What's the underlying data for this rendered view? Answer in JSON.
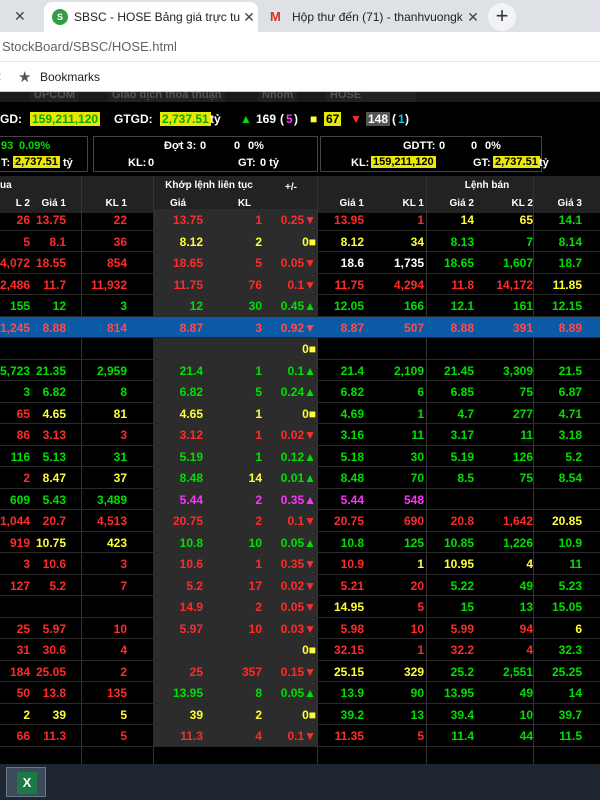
{
  "browser": {
    "tabs": [
      {
        "title": "SBSC - HOSE Bảng giá trực tuyến",
        "favicon": "S"
      },
      {
        "title": "Hộp thư đến (71) - thanhvuongk",
        "favicon": "M"
      }
    ],
    "close_glyph": "✕",
    "new_tab_glyph": "+",
    "url": "StockBoard/SBSC/HOSE.html",
    "bookmarks_label": "Bookmarks",
    "apps_glyph": ":"
  },
  "board": {
    "menu_tabs": [
      "UPCOM",
      "Giao dịch thỏa thuận",
      "Nhóm",
      "HOSE"
    ],
    "summary": {
      "gd_label": "GD:",
      "gd_value": "159,211,120",
      "gtgd_label": "GTGD:",
      "gtgd_value": "2,737.51",
      "gtgd_unit": "tỷ",
      "up_count": "169",
      "up_extra": "5",
      "ref_count": "67",
      "down_count": "148",
      "down_extra": "1"
    },
    "box1": {
      "line1_a": "93",
      "line1_b": "0.09%",
      "line2_a": "T:",
      "line2_b": "2,737.51",
      "line2_unit": "tỷ"
    },
    "box2": {
      "label": "Đợt 3:",
      "v1": "0",
      "v2": "0",
      "v3": "0%",
      "kl_label": "KL:",
      "kl": "0",
      "gt_label": "GT:",
      "gt": "0 tỷ"
    },
    "box3": {
      "label": "GDTT:",
      "v1": "0",
      "v2": "0",
      "v3": "0%",
      "kl_label": "KL:",
      "kl": "159,211,120",
      "gt_label": "GT:",
      "gt": "2,737.51",
      "gt_unit": "tỷ"
    },
    "header_groups": {
      "left": "ua",
      "match": "Khớp lệnh liên tục",
      "change": "+/-",
      "sell": "Lệnh bán"
    },
    "columns": [
      "L 2",
      "Giá 1",
      "KL 1",
      "Giá",
      "KL",
      "",
      "Giá 1",
      "KL 1",
      "Giá 2",
      "KL 2",
      "Giá 3"
    ],
    "rows": [
      {
        "c": [
          "26",
          "13.75",
          "22",
          "13.75",
          "1",
          "0.25▼",
          "13.95",
          "1",
          "14",
          "65",
          "14.1"
        ],
        "k": [
          "r",
          "r",
          "r",
          "r",
          "r",
          "r",
          "r",
          "r",
          "y",
          "y",
          "g"
        ]
      },
      {
        "c": [
          "5",
          "8.1",
          "36",
          "8.12",
          "2",
          "0■",
          "8.12",
          "34",
          "8.13",
          "7",
          "8.14"
        ],
        "k": [
          "r",
          "r",
          "r",
          "y",
          "y",
          "y",
          "y",
          "y",
          "g",
          "g",
          "g"
        ]
      },
      {
        "c": [
          "4,072",
          "18.55",
          "854",
          "18.65",
          "5",
          "0.05▼",
          "18.6",
          "1,735",
          "18.65",
          "1,607",
          "18.7"
        ],
        "k": [
          "r",
          "r",
          "r",
          "r",
          "r",
          "r",
          "w",
          "w",
          "g",
          "g",
          "g"
        ]
      },
      {
        "c": [
          "2,486",
          "11.7",
          "11,932",
          "11.75",
          "76",
          "0.1▼",
          "11.75",
          "4,294",
          "11.8",
          "14,172",
          "11.85"
        ],
        "k": [
          "r",
          "r",
          "r",
          "r",
          "r",
          "r",
          "r",
          "r",
          "r",
          "r",
          "y"
        ]
      },
      {
        "c": [
          "155",
          "12",
          "3",
          "12",
          "30",
          "0.45▲",
          "12.05",
          "166",
          "12.1",
          "161",
          "12.15"
        ],
        "k": [
          "g",
          "g",
          "g",
          "g",
          "g",
          "g",
          "g",
          "g",
          "g",
          "g",
          "g"
        ]
      },
      {
        "c": [
          "1,245",
          "8.88",
          "814",
          "8.87",
          "3",
          "0.92▼",
          "8.87",
          "507",
          "8.88",
          "391",
          "8.89"
        ],
        "k": [
          "r",
          "r",
          "r",
          "r",
          "r",
          "r",
          "r",
          "r",
          "r",
          "r",
          "r"
        ],
        "sel": true
      },
      {
        "c": [
          "",
          "",
          "",
          "",
          "",
          "0■",
          "",
          "",
          "",
          "",
          ""
        ],
        "k": [
          "w",
          "w",
          "w",
          "w",
          "w",
          "y",
          "w",
          "w",
          "w",
          "w",
          "w"
        ]
      },
      {
        "c": [
          "5,723",
          "21.35",
          "2,959",
          "21.4",
          "1",
          "0.1▲",
          "21.4",
          "2,109",
          "21.45",
          "3,309",
          "21.5"
        ],
        "k": [
          "g",
          "g",
          "g",
          "g",
          "g",
          "g",
          "g",
          "g",
          "g",
          "g",
          "g"
        ]
      },
      {
        "c": [
          "3",
          "6.82",
          "8",
          "6.82",
          "5",
          "0.24▲",
          "6.82",
          "6",
          "6.85",
          "75",
          "6.87"
        ],
        "k": [
          "g",
          "g",
          "g",
          "g",
          "g",
          "g",
          "g",
          "g",
          "g",
          "g",
          "g"
        ]
      },
      {
        "c": [
          "65",
          "4.65",
          "81",
          "4.65",
          "1",
          "0■",
          "4.69",
          "1",
          "4.7",
          "277",
          "4.71"
        ],
        "k": [
          "r",
          "y",
          "y",
          "y",
          "y",
          "y",
          "g",
          "g",
          "g",
          "g",
          "g"
        ]
      },
      {
        "c": [
          "86",
          "3.13",
          "3",
          "3.12",
          "1",
          "0.02▼",
          "3.16",
          "11",
          "3.17",
          "11",
          "3.18"
        ],
        "k": [
          "r",
          "r",
          "r",
          "r",
          "r",
          "r",
          "g",
          "g",
          "g",
          "g",
          "g"
        ]
      },
      {
        "c": [
          "116",
          "5.13",
          "31",
          "5.19",
          "1",
          "0.12▲",
          "5.18",
          "30",
          "5.19",
          "126",
          "5.2"
        ],
        "k": [
          "g",
          "g",
          "g",
          "g",
          "g",
          "g",
          "g",
          "g",
          "g",
          "g",
          "g"
        ]
      },
      {
        "c": [
          "2",
          "8.47",
          "37",
          "8.48",
          "14",
          "0.01▲",
          "8.48",
          "70",
          "8.5",
          "75",
          "8.54"
        ],
        "k": [
          "r",
          "y",
          "y",
          "g",
          "y",
          "g",
          "g",
          "g",
          "g",
          "g",
          "g"
        ]
      },
      {
        "c": [
          "609",
          "5.43",
          "3,489",
          "5.44",
          "2",
          "0.35▲",
          "5.44",
          "548",
          "",
          "",
          ""
        ],
        "k": [
          "g",
          "g",
          "g",
          "p",
          "p",
          "p",
          "p",
          "p",
          "w",
          "w",
          "w"
        ]
      },
      {
        "c": [
          "1,044",
          "20.7",
          "4,513",
          "20.75",
          "2",
          "0.1▼",
          "20.75",
          "690",
          "20.8",
          "1,642",
          "20.85"
        ],
        "k": [
          "r",
          "r",
          "r",
          "r",
          "r",
          "r",
          "r",
          "r",
          "r",
          "r",
          "y"
        ]
      },
      {
        "c": [
          "919",
          "10.75",
          "423",
          "10.8",
          "10",
          "0.05▲",
          "10.8",
          "125",
          "10.85",
          "1,226",
          "10.9"
        ],
        "k": [
          "r",
          "y",
          "y",
          "g",
          "g",
          "g",
          "g",
          "g",
          "g",
          "g",
          "g"
        ]
      },
      {
        "c": [
          "3",
          "10.6",
          "3",
          "10.6",
          "1",
          "0.35▼",
          "10.9",
          "1",
          "10.95",
          "4",
          "11"
        ],
        "k": [
          "r",
          "r",
          "r",
          "r",
          "r",
          "r",
          "r",
          "y",
          "y",
          "y",
          "g"
        ]
      },
      {
        "c": [
          "127",
          "5.2",
          "7",
          "5.2",
          "17",
          "0.02▼",
          "5.21",
          "20",
          "5.22",
          "49",
          "5.23"
        ],
        "k": [
          "r",
          "r",
          "r",
          "r",
          "r",
          "r",
          "r",
          "r",
          "g",
          "g",
          "g"
        ]
      },
      {
        "c": [
          "",
          "",
          "",
          "14.9",
          "2",
          "0.05▼",
          "14.95",
          "5",
          "15",
          "13",
          "15.05"
        ],
        "k": [
          "w",
          "w",
          "w",
          "r",
          "r",
          "r",
          "y",
          "r",
          "g",
          "g",
          "g"
        ]
      },
      {
        "c": [
          "25",
          "5.97",
          "10",
          "5.97",
          "10",
          "0.03▼",
          "5.98",
          "10",
          "5.99",
          "94",
          "6"
        ],
        "k": [
          "r",
          "r",
          "r",
          "r",
          "r",
          "r",
          "r",
          "r",
          "r",
          "r",
          "y"
        ]
      },
      {
        "c": [
          "31",
          "30.6",
          "4",
          "",
          "",
          "0■",
          "32.15",
          "1",
          "32.2",
          "4",
          "32.3"
        ],
        "k": [
          "r",
          "r",
          "r",
          "w",
          "w",
          "y",
          "r",
          "r",
          "r",
          "r",
          "g"
        ]
      },
      {
        "c": [
          "184",
          "25.05",
          "2",
          "25",
          "357",
          "0.15▼",
          "25.15",
          "329",
          "25.2",
          "2,551",
          "25.25"
        ],
        "k": [
          "r",
          "r",
          "r",
          "r",
          "r",
          "r",
          "y",
          "y",
          "g",
          "g",
          "g"
        ]
      },
      {
        "c": [
          "50",
          "13.8",
          "135",
          "13.95",
          "8",
          "0.05▲",
          "13.9",
          "90",
          "13.95",
          "49",
          "14"
        ],
        "k": [
          "r",
          "r",
          "r",
          "g",
          "g",
          "g",
          "g",
          "g",
          "g",
          "g",
          "g"
        ]
      },
      {
        "c": [
          "2",
          "39",
          "5",
          "39",
          "2",
          "0■",
          "39.2",
          "13",
          "39.4",
          "10",
          "39.7"
        ],
        "k": [
          "y",
          "y",
          "y",
          "y",
          "y",
          "y",
          "g",
          "g",
          "g",
          "g",
          "g"
        ]
      },
      {
        "c": [
          "66",
          "11.3",
          "5",
          "11.3",
          "4",
          "0.1▼",
          "11.35",
          "5",
          "11.4",
          "44",
          "11.5"
        ],
        "k": [
          "r",
          "r",
          "r",
          "r",
          "r",
          "r",
          "r",
          "r",
          "g",
          "g",
          "g"
        ]
      }
    ]
  },
  "taskbar": {
    "excel_glyph": "X"
  }
}
